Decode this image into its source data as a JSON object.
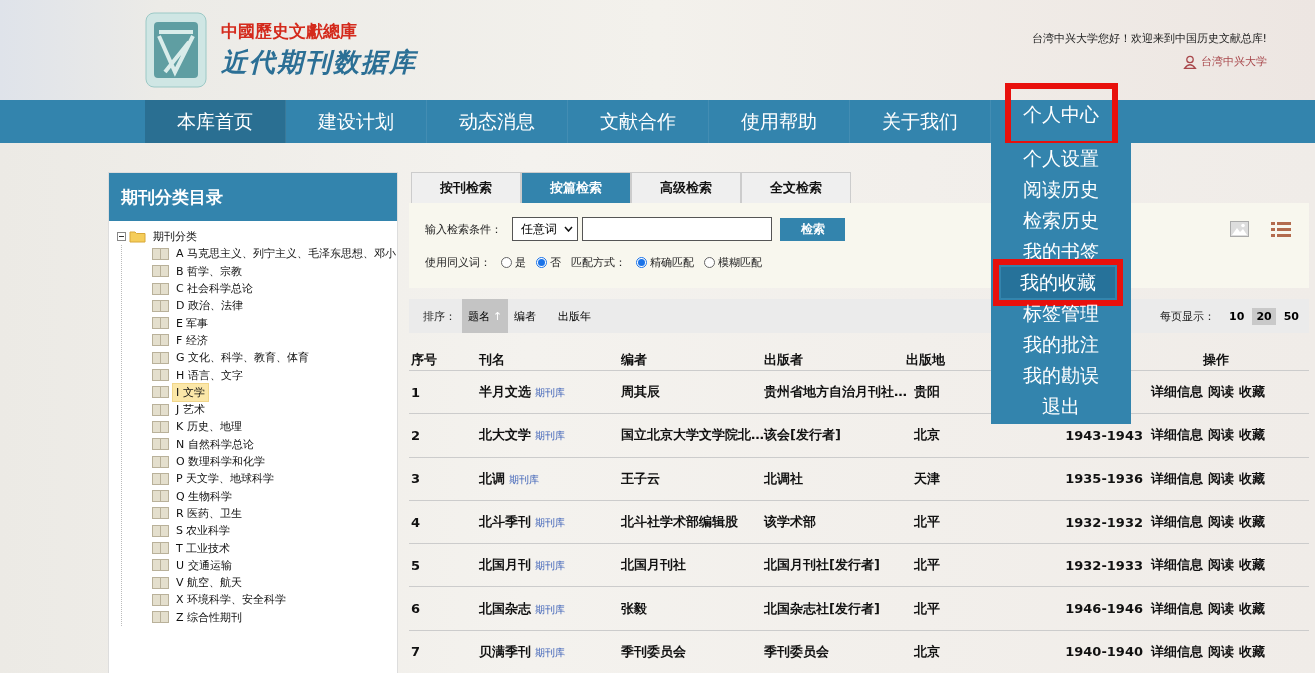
{
  "header": {
    "logo_top": "中國歷史文獻總庫",
    "logo_main": "近代期刊数据库",
    "welcome": "台湾中兴大学您好！欢迎来到中国历史文献总库!",
    "user": "台湾中兴大学"
  },
  "nav": [
    {
      "label": "本库首页",
      "selected": true,
      "highlighted": false
    },
    {
      "label": "建设计划",
      "selected": false,
      "highlighted": false
    },
    {
      "label": "动态消息",
      "selected": false,
      "highlighted": false
    },
    {
      "label": "文献合作",
      "selected": false,
      "highlighted": false
    },
    {
      "label": "使用帮助",
      "selected": false,
      "highlighted": false
    },
    {
      "label": "关于我们",
      "selected": false,
      "highlighted": false
    },
    {
      "label": "个人中心",
      "selected": false,
      "highlighted": true,
      "expanded": true
    }
  ],
  "menu": [
    {
      "label": "个人设置",
      "selected": false,
      "highlighted": false
    },
    {
      "label": "阅读历史",
      "selected": false,
      "highlighted": false
    },
    {
      "label": "检索历史",
      "selected": false,
      "highlighted": false
    },
    {
      "label": "我的书签",
      "selected": false,
      "highlighted": false
    },
    {
      "label": "我的收藏",
      "selected": true,
      "highlighted": true
    },
    {
      "label": "标签管理",
      "selected": false,
      "highlighted": false
    },
    {
      "label": "我的批注",
      "selected": false,
      "highlighted": false
    },
    {
      "label": "我的勘误",
      "selected": false,
      "highlighted": false
    },
    {
      "label": "退出",
      "selected": false,
      "highlighted": false
    }
  ],
  "sidebar": {
    "title": "期刊分类目录",
    "root": {
      "label": "期刊分类",
      "expanded": true,
      "children": [
        {
          "label": "A 马克思主义、列宁主义、毛泽东思想、邓小",
          "selected": false
        },
        {
          "label": "B 哲学、宗教",
          "selected": false
        },
        {
          "label": "C 社会科学总论",
          "selected": false
        },
        {
          "label": "D 政治、法律",
          "selected": false
        },
        {
          "label": "E 军事",
          "selected": false
        },
        {
          "label": "F 经济",
          "selected": false
        },
        {
          "label": "G 文化、科学、教育、体育",
          "selected": false
        },
        {
          "label": "H 语言、文字",
          "selected": false
        },
        {
          "label": "I 文学",
          "selected": true
        },
        {
          "label": "J 艺术",
          "selected": false
        },
        {
          "label": "K 历史、地理",
          "selected": false
        },
        {
          "label": "N 自然科学总论",
          "selected": false
        },
        {
          "label": "O 数理科学和化学",
          "selected": false
        },
        {
          "label": "P 天文学、地球科学",
          "selected": false
        },
        {
          "label": "Q 生物科学",
          "selected": false
        },
        {
          "label": "R 医药、卫生",
          "selected": false
        },
        {
          "label": "S 农业科学",
          "selected": false
        },
        {
          "label": "T 工业技术",
          "selected": false
        },
        {
          "label": "U 交通运输",
          "selected": false
        },
        {
          "label": "V 航空、航天",
          "selected": false
        },
        {
          "label": "X 环境科学、安全科学",
          "selected": false
        },
        {
          "label": "Z 综合性期刊",
          "selected": false
        }
      ]
    }
  },
  "search_tabs": [
    {
      "label": "按刊检索",
      "selected": false
    },
    {
      "label": "按篇检索",
      "selected": true
    },
    {
      "label": "高级检索",
      "selected": false
    },
    {
      "label": "全文检索",
      "selected": false
    }
  ],
  "search": {
    "label": "输入检索条件：",
    "field_select": "任意词",
    "button": "检索",
    "synonym_label": "使用同义词：",
    "synonym_options": [
      {
        "label": "是",
        "selected": false
      },
      {
        "label": "否",
        "selected": true
      }
    ],
    "match_label": "匹配方式：",
    "match_options": [
      {
        "label": "精确匹配",
        "selected": true
      },
      {
        "label": "模糊匹配",
        "selected": false
      }
    ]
  },
  "sort": {
    "label": "排序：",
    "options": [
      {
        "label": "题名",
        "selected": true,
        "arrow": "↑"
      },
      {
        "label": "编者",
        "selected": false
      },
      {
        "label": "出版年",
        "selected": false
      }
    ],
    "page_size_label": "每页显示：",
    "page_sizes": [
      {
        "label": "10",
        "selected": false
      },
      {
        "label": "20",
        "selected": true
      },
      {
        "label": "50",
        "selected": false
      }
    ]
  },
  "table": {
    "columns": [
      "序号",
      "刊名",
      "编者",
      "出版者",
      "出版地",
      "操作"
    ],
    "rows": [
      {
        "no": "1",
        "title": "半月文选",
        "tag": "期刊库",
        "editor": "周其辰",
        "publisher": "贵州省地方自治月刊社…",
        "place": "贵阳",
        "actions": [
          "详细信息",
          "阅读",
          "收藏"
        ]
      },
      {
        "no": "2",
        "title": "北大文学",
        "tag": "期刊库",
        "editor": "国立北京大学文学院北…",
        "publisher": "该会[发行者]",
        "place": "北京",
        "years": "1943-1943",
        "actions": [
          "详细信息",
          "阅读",
          "收藏"
        ]
      },
      {
        "no": "3",
        "title": "北调",
        "tag": "期刊库",
        "editor": "王子云",
        "publisher": "北调社",
        "place": "天津",
        "years": "1935-1936",
        "actions": [
          "详细信息",
          "阅读",
          "收藏"
        ]
      },
      {
        "no": "4",
        "title": "北斗季刊",
        "tag": "期刊库",
        "editor": "北斗社学术部编辑股",
        "publisher": "该学术部",
        "place": "北平",
        "years": "1932-1932",
        "actions": [
          "详细信息",
          "阅读",
          "收藏"
        ]
      },
      {
        "no": "5",
        "title": "北国月刊",
        "tag": "期刊库",
        "editor": "北国月刊社",
        "publisher": "北国月刊社[发行者]",
        "place": "北平",
        "years": "1932-1933",
        "actions": [
          "详细信息",
          "阅读",
          "收藏"
        ]
      },
      {
        "no": "6",
        "title": "北国杂志",
        "tag": "期刊库",
        "editor": "张毅",
        "publisher": "北国杂志社[发行者]",
        "place": "北平",
        "years": "1946-1946",
        "actions": [
          "详细信息",
          "阅读",
          "收藏"
        ]
      },
      {
        "no": "7",
        "title": "贝满季刊",
        "tag": "期刊库",
        "editor": "季刊委员会",
        "publisher": "季刊委员会",
        "place": "北京",
        "years": "1940-1940",
        "actions": [
          "详细信息",
          "阅读",
          "收藏"
        ]
      }
    ]
  }
}
